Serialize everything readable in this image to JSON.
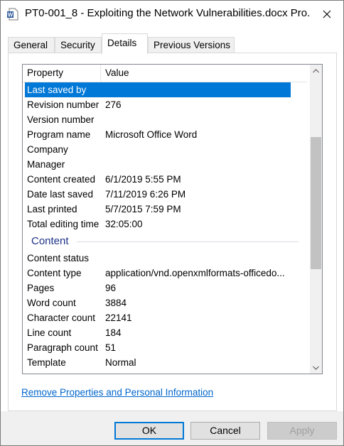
{
  "window": {
    "title": "PT0-001_8 - Exploiting the Network Vulnerabilities.docx Pro...",
    "close_symbol": "✕",
    "app_icon": "word-document-icon",
    "app_icon_letter": "W"
  },
  "tabs": [
    {
      "label": "General",
      "active": false
    },
    {
      "label": "Security",
      "active": false
    },
    {
      "label": "Details",
      "active": true
    },
    {
      "label": "Previous Versions",
      "active": false
    }
  ],
  "list": {
    "headers": {
      "property": "Property",
      "value": "Value"
    },
    "rows": [
      {
        "property": "Last saved by",
        "value": "",
        "selected": true
      },
      {
        "property": "Revision number",
        "value": "276"
      },
      {
        "property": "Version number",
        "value": ""
      },
      {
        "property": "Program name",
        "value": "Microsoft Office Word"
      },
      {
        "property": "Company",
        "value": ""
      },
      {
        "property": "Manager",
        "value": ""
      },
      {
        "property": "Content created",
        "value": "6/1/2019 5:55 PM"
      },
      {
        "property": "Date last saved",
        "value": "7/11/2019 6:26 PM"
      },
      {
        "property": "Last printed",
        "value": "5/7/2015 7:59 PM"
      },
      {
        "property": "Total editing time",
        "value": "32:05:00"
      }
    ],
    "section_content": "Content",
    "content_rows": [
      {
        "property": "Content status",
        "value": ""
      },
      {
        "property": "Content type",
        "value": "application/vnd.openxmlformats-officedo..."
      },
      {
        "property": "Pages",
        "value": "96"
      },
      {
        "property": "Word count",
        "value": "3884"
      },
      {
        "property": "Character count",
        "value": "22141"
      },
      {
        "property": "Line count",
        "value": "184"
      },
      {
        "property": "Paragraph count",
        "value": "51"
      },
      {
        "property": "Template",
        "value": "Normal"
      }
    ]
  },
  "remove_link": "Remove Properties and Personal Information",
  "buttons": {
    "ok": "OK",
    "cancel": "Cancel",
    "apply": "Apply"
  },
  "colors": {
    "selection": "#0078d7",
    "link": "#0066cc",
    "section": "#1e3287"
  }
}
